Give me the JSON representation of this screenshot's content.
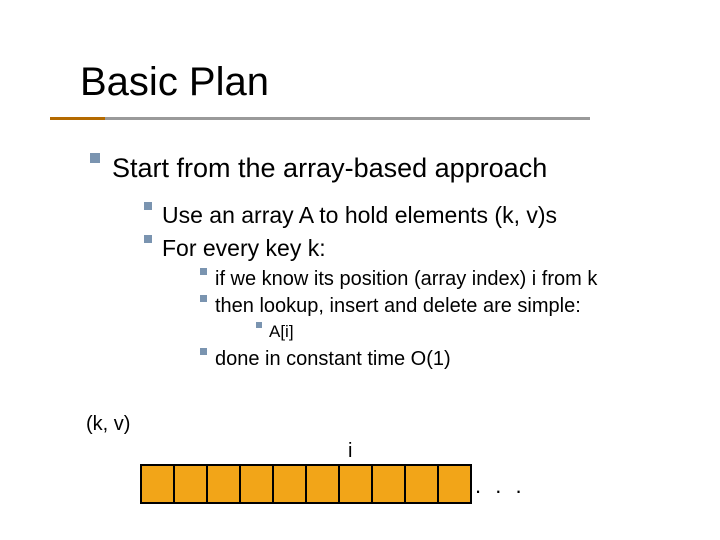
{
  "title": "Basic Plan",
  "bullets": {
    "l1": "Start from the array-based approach",
    "l2a": "Use an array A to hold elements (k, v)s",
    "l2b": "For every key k:",
    "l3a": "if we know its position (array index) i from k",
    "l3b": "then lookup, insert and delete are simple:",
    "l4a": "A[i]",
    "l3c": "done in constant time O(1)"
  },
  "labels": {
    "kv": "(k, v)",
    "index": "i",
    "dots": ". . ."
  },
  "array": {
    "cell_count": 10
  },
  "colors": {
    "bullet": "#7a94b0",
    "cell_fill": "#f2a518",
    "rule_accent": "#b46a00",
    "rule_base": "#9a9a9a"
  }
}
